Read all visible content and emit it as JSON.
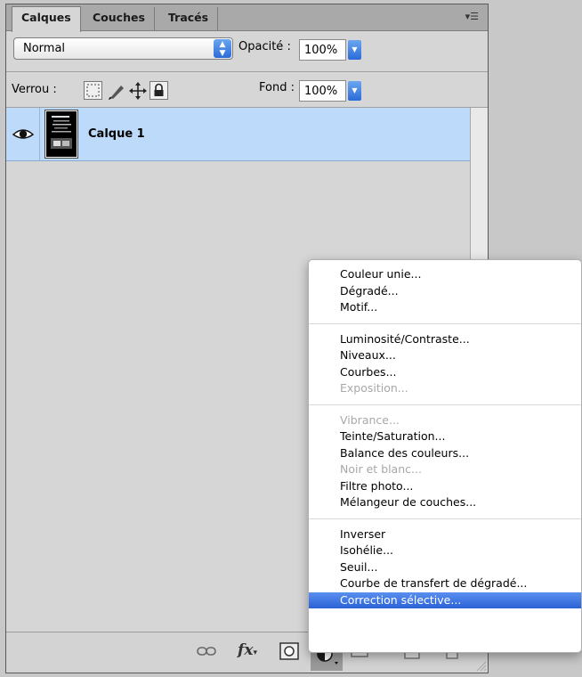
{
  "tabs": [
    {
      "label": "Calques",
      "active": true
    },
    {
      "label": "Couches",
      "active": false
    },
    {
      "label": "Tracés",
      "active": false
    }
  ],
  "blend_mode": {
    "value": "Normal"
  },
  "opacity": {
    "label": "Opacité :",
    "value": "100%"
  },
  "lock": {
    "label": "Verrou :"
  },
  "fill": {
    "label": "Fond :",
    "value": "100%"
  },
  "layers": [
    {
      "name": "Calque 1",
      "visible": true,
      "selected": true
    }
  ],
  "colors": {
    "selection": "#bedafb",
    "menu_highlight": "#3a72e0"
  },
  "adjustment_menu": {
    "groups": [
      [
        {
          "label": "Couleur unie...",
          "enabled": true
        },
        {
          "label": "Dégradé...",
          "enabled": true
        },
        {
          "label": "Motif...",
          "enabled": true
        }
      ],
      [
        {
          "label": "Luminosité/Contraste...",
          "enabled": true
        },
        {
          "label": "Niveaux...",
          "enabled": true
        },
        {
          "label": "Courbes...",
          "enabled": true
        },
        {
          "label": "Exposition...",
          "enabled": false
        }
      ],
      [
        {
          "label": "Vibrance...",
          "enabled": false
        },
        {
          "label": "Teinte/Saturation...",
          "enabled": true
        },
        {
          "label": "Balance des couleurs...",
          "enabled": true
        },
        {
          "label": "Noir et blanc...",
          "enabled": false
        },
        {
          "label": "Filtre photo...",
          "enabled": true
        },
        {
          "label": "Mélangeur de couches...",
          "enabled": true
        }
      ],
      [
        {
          "label": "Inverser",
          "enabled": true
        },
        {
          "label": "Isohélie...",
          "enabled": true
        },
        {
          "label": "Seuil...",
          "enabled": true
        },
        {
          "label": "Courbe de transfert de dégradé...",
          "enabled": true
        },
        {
          "label": "Correction sélective...",
          "enabled": true,
          "selected": true
        }
      ]
    ]
  },
  "bottom_icons": [
    "link-icon",
    "fx-icon",
    "mask-icon",
    "adjustment-icon",
    "group-icon",
    "new-layer-icon",
    "trash-icon"
  ]
}
